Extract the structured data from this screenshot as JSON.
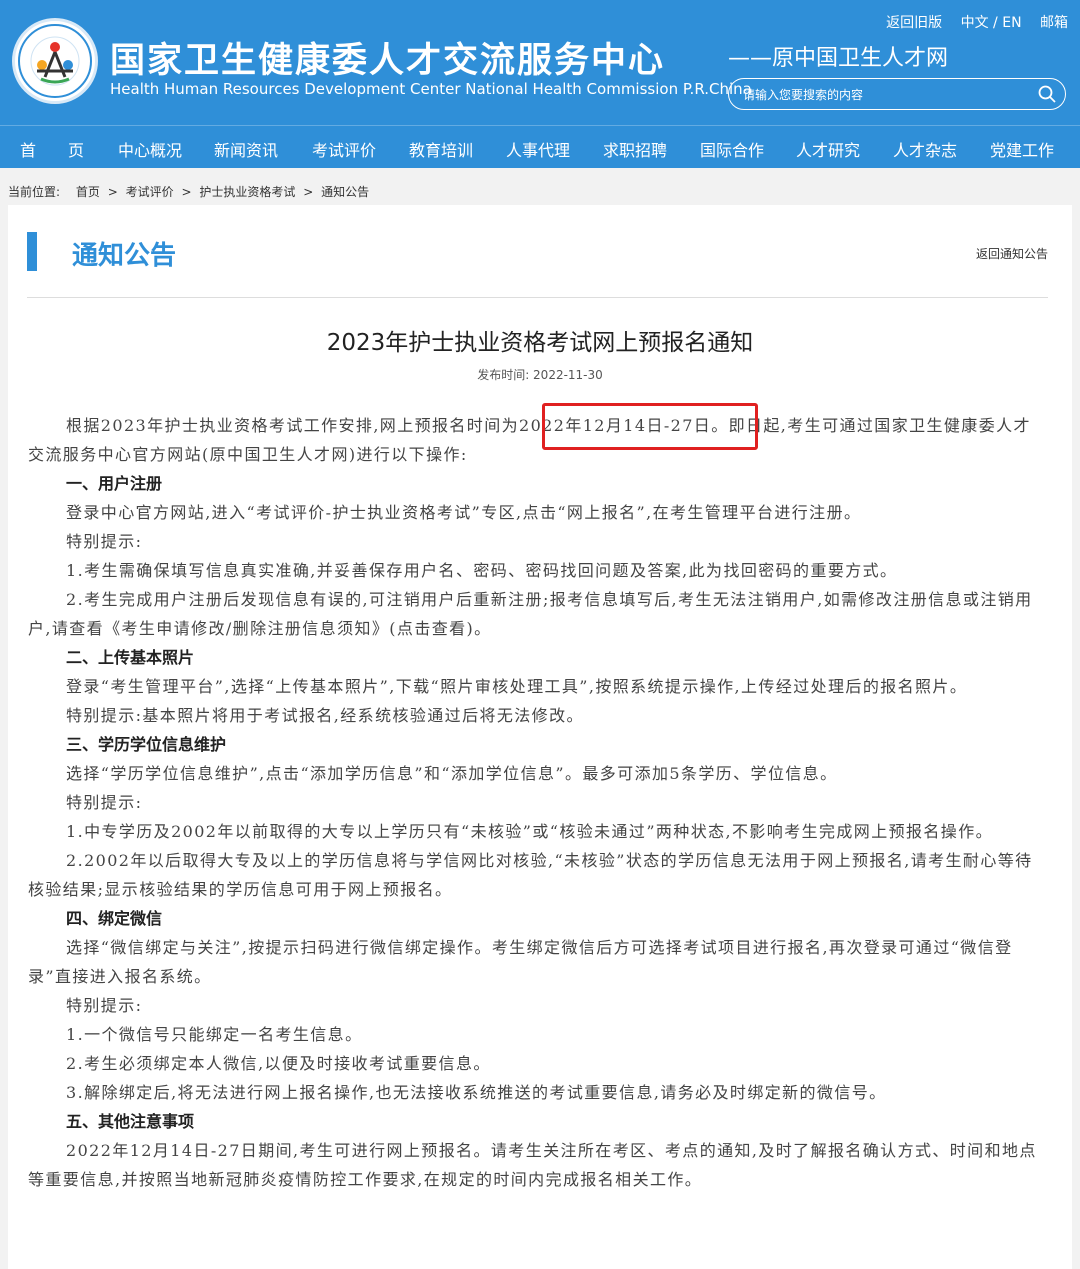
{
  "header": {
    "title_cn": "国家卫生健康委人才交流服务中心",
    "title_en": "Health Human Resources Development Center National Health Commission P.R.China",
    "subtitle": "——原中国卫生人才网",
    "links": {
      "old_version": "返回旧版",
      "language": "中文 / EN",
      "mail": "邮箱"
    },
    "search_placeholder": "请输入您要搜索的内容",
    "colors": {
      "brand": "#2f8fd8",
      "highlight": "#e02020"
    }
  },
  "nav": [
    "首　　页",
    "中心概况",
    "新闻资讯",
    "考试评价",
    "教育培训",
    "人事代理",
    "求职招聘",
    "国际合作",
    "人才研究",
    "人才杂志",
    "党建工作"
  ],
  "breadcrumb": {
    "prefix": "当前位置:",
    "items": [
      "首页",
      "考试评价",
      "护士执业资格考试",
      "通知公告"
    ]
  },
  "section": {
    "title": "通知公告",
    "back_link": "返回通知公告"
  },
  "article": {
    "title": "2023年护士执业资格考试网上预报名通知",
    "published": "发布时间: 2022-11-30",
    "paragraphs": [
      {
        "type": "p",
        "text": "根据2023年护士执业资格考试工作安排,网上预报名时间为2022年12月14日-27日。即日起,考生可通过国家卫生健康委人才交流服务中心官方网站(原中国卫生人才网)进行以下操作:"
      },
      {
        "type": "h",
        "text": "一、用户注册"
      },
      {
        "type": "p",
        "text": "登录中心官方网站,进入“考试评价-护士执业资格考试”专区,点击“网上报名”,在考生管理平台进行注册。"
      },
      {
        "type": "p",
        "text": "特别提示:"
      },
      {
        "type": "p",
        "text": "1.考生需确保填写信息真实准确,并妥善保存用户名、密码、密码找回问题及答案,此为找回密码的重要方式。"
      },
      {
        "type": "p",
        "text": "2.考生完成用户注册后发现信息有误的,可注销用户后重新注册;报考信息填写后,考生无法注销用户,如需修改注册信息或注销用户,请查看《考生申请修改/删除注册信息须知》(点击查看)。"
      },
      {
        "type": "h",
        "text": "二、上传基本照片"
      },
      {
        "type": "p",
        "text": "登录“考生管理平台”,选择“上传基本照片”,下载“照片审核处理工具”,按照系统提示操作,上传经过处理后的报名照片。"
      },
      {
        "type": "p",
        "text": "特别提示:基本照片将用于考试报名,经系统核验通过后将无法修改。"
      },
      {
        "type": "h",
        "text": "三、学历学位信息维护"
      },
      {
        "type": "p",
        "text": "选择“学历学位信息维护”,点击“添加学历信息”和“添加学位信息”。最多可添加5条学历、学位信息。"
      },
      {
        "type": "p",
        "text": "特别提示:"
      },
      {
        "type": "p",
        "text": "1.中专学历及2002年以前取得的大专以上学历只有“未核验”或“核验未通过”两种状态,不影响考生完成网上预报名操作。"
      },
      {
        "type": "p",
        "text": "2.2002年以后取得大专及以上的学历信息将与学信网比对核验,“未核验”状态的学历信息无法用于网上预报名,请考生耐心等待核验结果;显示核验结果的学历信息可用于网上预报名。"
      },
      {
        "type": "h",
        "text": "四、绑定微信"
      },
      {
        "type": "p",
        "text": "选择“微信绑定与关注”,按提示扫码进行微信绑定操作。考生绑定微信后方可选择考试项目进行报名,再次登录可通过“微信登录”直接进入报名系统。"
      },
      {
        "type": "p",
        "text": "特别提示:"
      },
      {
        "type": "p",
        "text": "1.一个微信号只能绑定一名考生信息。"
      },
      {
        "type": "p",
        "text": "2.考生必须绑定本人微信,以便及时接收考试重要信息。"
      },
      {
        "type": "p",
        "text": "3.解除绑定后,将无法进行网上报名操作,也无法接收系统推送的考试重要信息,请务必及时绑定新的微信号。"
      },
      {
        "type": "h",
        "text": "五、其他注意事项"
      },
      {
        "type": "p",
        "text": "2022年12月14日-27日期间,考生可进行网上预报名。请考生关注所在考区、考点的通知,及时了解报名确认方式、时间和地点等重要信息,并按照当地新冠肺炎疫情防控工作要求,在规定的时间内完成报名相关工作。"
      }
    ]
  }
}
